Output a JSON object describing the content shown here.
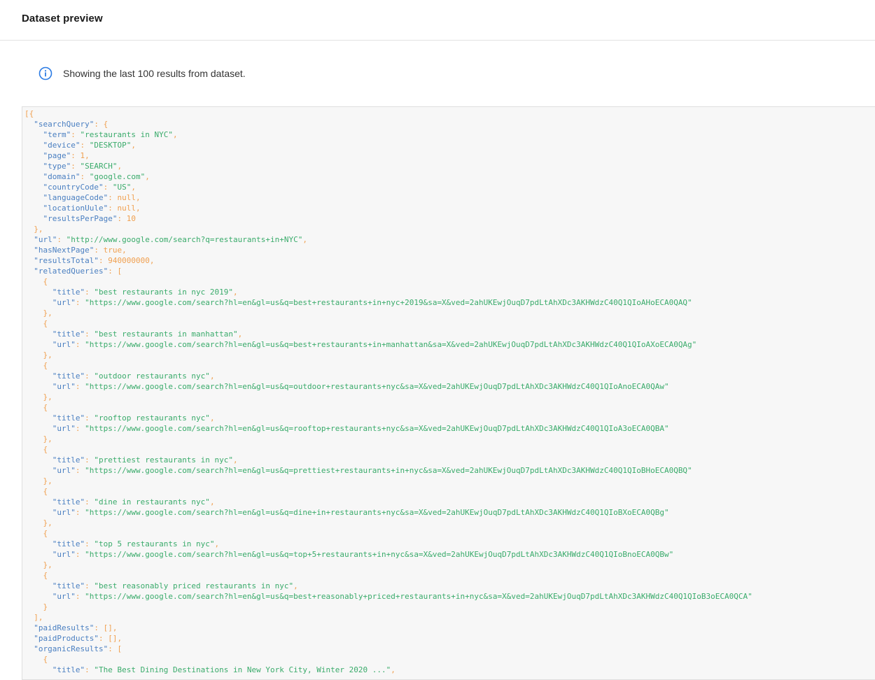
{
  "header": {
    "title": "Dataset preview"
  },
  "notice": {
    "icon": "info-icon",
    "text": "Showing the last 100 results from dataset."
  },
  "colors": {
    "key": "#4a7fc1",
    "string": "#3aab6b",
    "punct": "#f0a050",
    "accent": "#2b7be4"
  },
  "code_lines": [
    [
      {
        "t": "p",
        "v": "[{"
      }
    ],
    [
      {
        "t": "p",
        "v": "  "
      },
      {
        "t": "k",
        "v": "\"searchQuery\""
      },
      {
        "t": "p",
        "v": ": {"
      }
    ],
    [
      {
        "t": "p",
        "v": "    "
      },
      {
        "t": "k",
        "v": "\"term\""
      },
      {
        "t": "p",
        "v": ": "
      },
      {
        "t": "s",
        "v": "\"restaurants in NYC\""
      },
      {
        "t": "p",
        "v": ","
      }
    ],
    [
      {
        "t": "p",
        "v": "    "
      },
      {
        "t": "k",
        "v": "\"device\""
      },
      {
        "t": "p",
        "v": ": "
      },
      {
        "t": "s",
        "v": "\"DESKTOP\""
      },
      {
        "t": "p",
        "v": ","
      }
    ],
    [
      {
        "t": "p",
        "v": "    "
      },
      {
        "t": "k",
        "v": "\"page\""
      },
      {
        "t": "p",
        "v": ": "
      },
      {
        "t": "n",
        "v": "1"
      },
      {
        "t": "p",
        "v": ","
      }
    ],
    [
      {
        "t": "p",
        "v": "    "
      },
      {
        "t": "k",
        "v": "\"type\""
      },
      {
        "t": "p",
        "v": ": "
      },
      {
        "t": "s",
        "v": "\"SEARCH\""
      },
      {
        "t": "p",
        "v": ","
      }
    ],
    [
      {
        "t": "p",
        "v": "    "
      },
      {
        "t": "k",
        "v": "\"domain\""
      },
      {
        "t": "p",
        "v": ": "
      },
      {
        "t": "s",
        "v": "\"google.com\""
      },
      {
        "t": "p",
        "v": ","
      }
    ],
    [
      {
        "t": "p",
        "v": "    "
      },
      {
        "t": "k",
        "v": "\"countryCode\""
      },
      {
        "t": "p",
        "v": ": "
      },
      {
        "t": "s",
        "v": "\"US\""
      },
      {
        "t": "p",
        "v": ","
      }
    ],
    [
      {
        "t": "p",
        "v": "    "
      },
      {
        "t": "k",
        "v": "\"languageCode\""
      },
      {
        "t": "p",
        "v": ": "
      },
      {
        "t": "n",
        "v": "null"
      },
      {
        "t": "p",
        "v": ","
      }
    ],
    [
      {
        "t": "p",
        "v": "    "
      },
      {
        "t": "k",
        "v": "\"locationUule\""
      },
      {
        "t": "p",
        "v": ": "
      },
      {
        "t": "n",
        "v": "null"
      },
      {
        "t": "p",
        "v": ","
      }
    ],
    [
      {
        "t": "p",
        "v": "    "
      },
      {
        "t": "k",
        "v": "\"resultsPerPage\""
      },
      {
        "t": "p",
        "v": ": "
      },
      {
        "t": "n",
        "v": "10"
      }
    ],
    [
      {
        "t": "p",
        "v": "  },"
      }
    ],
    [
      {
        "t": "p",
        "v": "  "
      },
      {
        "t": "k",
        "v": "\"url\""
      },
      {
        "t": "p",
        "v": ": "
      },
      {
        "t": "s",
        "v": "\"http://www.google.com/search?q=restaurants+in+NYC\""
      },
      {
        "t": "p",
        "v": ","
      }
    ],
    [
      {
        "t": "p",
        "v": "  "
      },
      {
        "t": "k",
        "v": "\"hasNextPage\""
      },
      {
        "t": "p",
        "v": ": "
      },
      {
        "t": "n",
        "v": "true"
      },
      {
        "t": "p",
        "v": ","
      }
    ],
    [
      {
        "t": "p",
        "v": "  "
      },
      {
        "t": "k",
        "v": "\"resultsTotal\""
      },
      {
        "t": "p",
        "v": ": "
      },
      {
        "t": "n",
        "v": "940000000"
      },
      {
        "t": "p",
        "v": ","
      }
    ],
    [
      {
        "t": "p",
        "v": "  "
      },
      {
        "t": "k",
        "v": "\"relatedQueries\""
      },
      {
        "t": "p",
        "v": ": ["
      }
    ],
    [
      {
        "t": "p",
        "v": "    {"
      }
    ],
    [
      {
        "t": "p",
        "v": "      "
      },
      {
        "t": "k",
        "v": "\"title\""
      },
      {
        "t": "p",
        "v": ": "
      },
      {
        "t": "s",
        "v": "\"best restaurants in nyc 2019\""
      },
      {
        "t": "p",
        "v": ","
      }
    ],
    [
      {
        "t": "p",
        "v": "      "
      },
      {
        "t": "k",
        "v": "\"url\""
      },
      {
        "t": "p",
        "v": ": "
      },
      {
        "t": "s",
        "v": "\"https://www.google.com/search?hl=en&gl=us&q=best+restaurants+in+nyc+2019&sa=X&ved=2ahUKEwjOuqD7pdLtAhXDc3AKHWdzC40Q1QIoAHoECA0QAQ\""
      }
    ],
    [
      {
        "t": "p",
        "v": "    },"
      }
    ],
    [
      {
        "t": "p",
        "v": "    {"
      }
    ],
    [
      {
        "t": "p",
        "v": "      "
      },
      {
        "t": "k",
        "v": "\"title\""
      },
      {
        "t": "p",
        "v": ": "
      },
      {
        "t": "s",
        "v": "\"best restaurants in manhattan\""
      },
      {
        "t": "p",
        "v": ","
      }
    ],
    [
      {
        "t": "p",
        "v": "      "
      },
      {
        "t": "k",
        "v": "\"url\""
      },
      {
        "t": "p",
        "v": ": "
      },
      {
        "t": "s",
        "v": "\"https://www.google.com/search?hl=en&gl=us&q=best+restaurants+in+manhattan&sa=X&ved=2ahUKEwjOuqD7pdLtAhXDc3AKHWdzC40Q1QIoAXoECA0QAg\""
      }
    ],
    [
      {
        "t": "p",
        "v": "    },"
      }
    ],
    [
      {
        "t": "p",
        "v": "    {"
      }
    ],
    [
      {
        "t": "p",
        "v": "      "
      },
      {
        "t": "k",
        "v": "\"title\""
      },
      {
        "t": "p",
        "v": ": "
      },
      {
        "t": "s",
        "v": "\"outdoor restaurants nyc\""
      },
      {
        "t": "p",
        "v": ","
      }
    ],
    [
      {
        "t": "p",
        "v": "      "
      },
      {
        "t": "k",
        "v": "\"url\""
      },
      {
        "t": "p",
        "v": ": "
      },
      {
        "t": "s",
        "v": "\"https://www.google.com/search?hl=en&gl=us&q=outdoor+restaurants+nyc&sa=X&ved=2ahUKEwjOuqD7pdLtAhXDc3AKHWdzC40Q1QIoAnoECA0QAw\""
      }
    ],
    [
      {
        "t": "p",
        "v": "    },"
      }
    ],
    [
      {
        "t": "p",
        "v": "    {"
      }
    ],
    [
      {
        "t": "p",
        "v": "      "
      },
      {
        "t": "k",
        "v": "\"title\""
      },
      {
        "t": "p",
        "v": ": "
      },
      {
        "t": "s",
        "v": "\"rooftop restaurants nyc\""
      },
      {
        "t": "p",
        "v": ","
      }
    ],
    [
      {
        "t": "p",
        "v": "      "
      },
      {
        "t": "k",
        "v": "\"url\""
      },
      {
        "t": "p",
        "v": ": "
      },
      {
        "t": "s",
        "v": "\"https://www.google.com/search?hl=en&gl=us&q=rooftop+restaurants+nyc&sa=X&ved=2ahUKEwjOuqD7pdLtAhXDc3AKHWdzC40Q1QIoA3oECA0QBA\""
      }
    ],
    [
      {
        "t": "p",
        "v": "    },"
      }
    ],
    [
      {
        "t": "p",
        "v": "    {"
      }
    ],
    [
      {
        "t": "p",
        "v": "      "
      },
      {
        "t": "k",
        "v": "\"title\""
      },
      {
        "t": "p",
        "v": ": "
      },
      {
        "t": "s",
        "v": "\"prettiest restaurants in nyc\""
      },
      {
        "t": "p",
        "v": ","
      }
    ],
    [
      {
        "t": "p",
        "v": "      "
      },
      {
        "t": "k",
        "v": "\"url\""
      },
      {
        "t": "p",
        "v": ": "
      },
      {
        "t": "s",
        "v": "\"https://www.google.com/search?hl=en&gl=us&q=prettiest+restaurants+in+nyc&sa=X&ved=2ahUKEwjOuqD7pdLtAhXDc3AKHWdzC40Q1QIoBHoECA0QBQ\""
      }
    ],
    [
      {
        "t": "p",
        "v": "    },"
      }
    ],
    [
      {
        "t": "p",
        "v": "    {"
      }
    ],
    [
      {
        "t": "p",
        "v": "      "
      },
      {
        "t": "k",
        "v": "\"title\""
      },
      {
        "t": "p",
        "v": ": "
      },
      {
        "t": "s",
        "v": "\"dine in restaurants nyc\""
      },
      {
        "t": "p",
        "v": ","
      }
    ],
    [
      {
        "t": "p",
        "v": "      "
      },
      {
        "t": "k",
        "v": "\"url\""
      },
      {
        "t": "p",
        "v": ": "
      },
      {
        "t": "s",
        "v": "\"https://www.google.com/search?hl=en&gl=us&q=dine+in+restaurants+nyc&sa=X&ved=2ahUKEwjOuqD7pdLtAhXDc3AKHWdzC40Q1QIoBXoECA0QBg\""
      }
    ],
    [
      {
        "t": "p",
        "v": "    },"
      }
    ],
    [
      {
        "t": "p",
        "v": "    {"
      }
    ],
    [
      {
        "t": "p",
        "v": "      "
      },
      {
        "t": "k",
        "v": "\"title\""
      },
      {
        "t": "p",
        "v": ": "
      },
      {
        "t": "s",
        "v": "\"top 5 restaurants in nyc\""
      },
      {
        "t": "p",
        "v": ","
      }
    ],
    [
      {
        "t": "p",
        "v": "      "
      },
      {
        "t": "k",
        "v": "\"url\""
      },
      {
        "t": "p",
        "v": ": "
      },
      {
        "t": "s",
        "v": "\"https://www.google.com/search?hl=en&gl=us&q=top+5+restaurants+in+nyc&sa=X&ved=2ahUKEwjOuqD7pdLtAhXDc3AKHWdzC40Q1QIoBnoECA0QBw\""
      }
    ],
    [
      {
        "t": "p",
        "v": "    },"
      }
    ],
    [
      {
        "t": "p",
        "v": "    {"
      }
    ],
    [
      {
        "t": "p",
        "v": "      "
      },
      {
        "t": "k",
        "v": "\"title\""
      },
      {
        "t": "p",
        "v": ": "
      },
      {
        "t": "s",
        "v": "\"best reasonably priced restaurants in nyc\""
      },
      {
        "t": "p",
        "v": ","
      }
    ],
    [
      {
        "t": "p",
        "v": "      "
      },
      {
        "t": "k",
        "v": "\"url\""
      },
      {
        "t": "p",
        "v": ": "
      },
      {
        "t": "s",
        "v": "\"https://www.google.com/search?hl=en&gl=us&q=best+reasonably+priced+restaurants+in+nyc&sa=X&ved=2ahUKEwjOuqD7pdLtAhXDc3AKHWdzC40Q1QIoB3oECA0QCA\""
      }
    ],
    [
      {
        "t": "p",
        "v": "    }"
      }
    ],
    [
      {
        "t": "p",
        "v": "  ],"
      }
    ],
    [
      {
        "t": "p",
        "v": "  "
      },
      {
        "t": "k",
        "v": "\"paidResults\""
      },
      {
        "t": "p",
        "v": ": [],"
      }
    ],
    [
      {
        "t": "p",
        "v": "  "
      },
      {
        "t": "k",
        "v": "\"paidProducts\""
      },
      {
        "t": "p",
        "v": ": [],"
      }
    ],
    [
      {
        "t": "p",
        "v": "  "
      },
      {
        "t": "k",
        "v": "\"organicResults\""
      },
      {
        "t": "p",
        "v": ": ["
      }
    ],
    [
      {
        "t": "p",
        "v": "    {"
      }
    ],
    [
      {
        "t": "p",
        "v": "      "
      },
      {
        "t": "k",
        "v": "\"title\""
      },
      {
        "t": "p",
        "v": ": "
      },
      {
        "t": "s",
        "v": "\"The Best Dining Destinations in New York City, Winter 2020 ...\""
      },
      {
        "t": "p",
        "v": ","
      }
    ]
  ]
}
